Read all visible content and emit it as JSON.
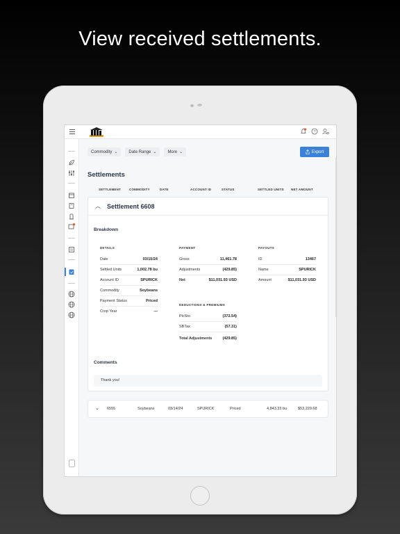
{
  "headline": "View received settlements.",
  "toolbar": {
    "filters": [
      {
        "label": "Commodity"
      },
      {
        "label": "Date Range"
      },
      {
        "label": "More"
      }
    ],
    "export_label": "Export"
  },
  "page_title": "Settlements",
  "table_columns": [
    "SETTLEMENT",
    "COMMODITY",
    "DATE",
    "ACCOUNT ID",
    "STATUS",
    "SETTLED UNITS",
    "NET AMOUNT"
  ],
  "notification_badge": "1",
  "settlement_card": {
    "title": "Settlement 6608",
    "breakdown_label": "Breakdown",
    "details": {
      "heading": "DETAILS",
      "rows": [
        {
          "key": "Date",
          "value": "03/15/24"
        },
        {
          "key": "Settled Units",
          "value": "1,002.78 bu"
        },
        {
          "key": "Account ID",
          "value": "SPURICK"
        },
        {
          "key": "Commodity",
          "value": "Soybeans"
        },
        {
          "key": "Payment Status",
          "value": "Priced"
        },
        {
          "key": "Crop Year",
          "value": "—"
        }
      ]
    },
    "payment": {
      "heading": "PAYMENT",
      "rows": [
        {
          "key": "Gross",
          "value": "11,461.78"
        },
        {
          "key": "Adjustments",
          "value": "(429.85)"
        },
        {
          "key": "Net",
          "value": "$11,031.93 USD"
        }
      ]
    },
    "deductions": {
      "heading": "DEDUCTIONS & PREMIUMS",
      "rows": [
        {
          "key": "PlcSto",
          "value": "(372.54)"
        },
        {
          "key": "SBTax",
          "value": "(57.31)"
        },
        {
          "key": "Total Adjustments",
          "value": "(429.85)"
        }
      ]
    },
    "payouts": {
      "heading": "PAYOUTS",
      "rows": [
        {
          "key": "ID",
          "value": "13467"
        },
        {
          "key": "Name",
          "value": "SPURICK"
        },
        {
          "key": "Amount",
          "value": "$11,031.93 USD"
        }
      ]
    },
    "comments_label": "Comments",
    "comment": "Thank you!"
  },
  "settlement_row": {
    "settlement": "6555",
    "commodity": "Soybeans",
    "date": "03/14/24",
    "account_id": "SPURICK",
    "status": "Priced",
    "settled_units": "4,843.33 bu",
    "net_amount": "$53,229.68"
  },
  "colors": {
    "accent": "#3b82d6",
    "badge": "#e05a3a",
    "title_text": "#2b3647"
  }
}
